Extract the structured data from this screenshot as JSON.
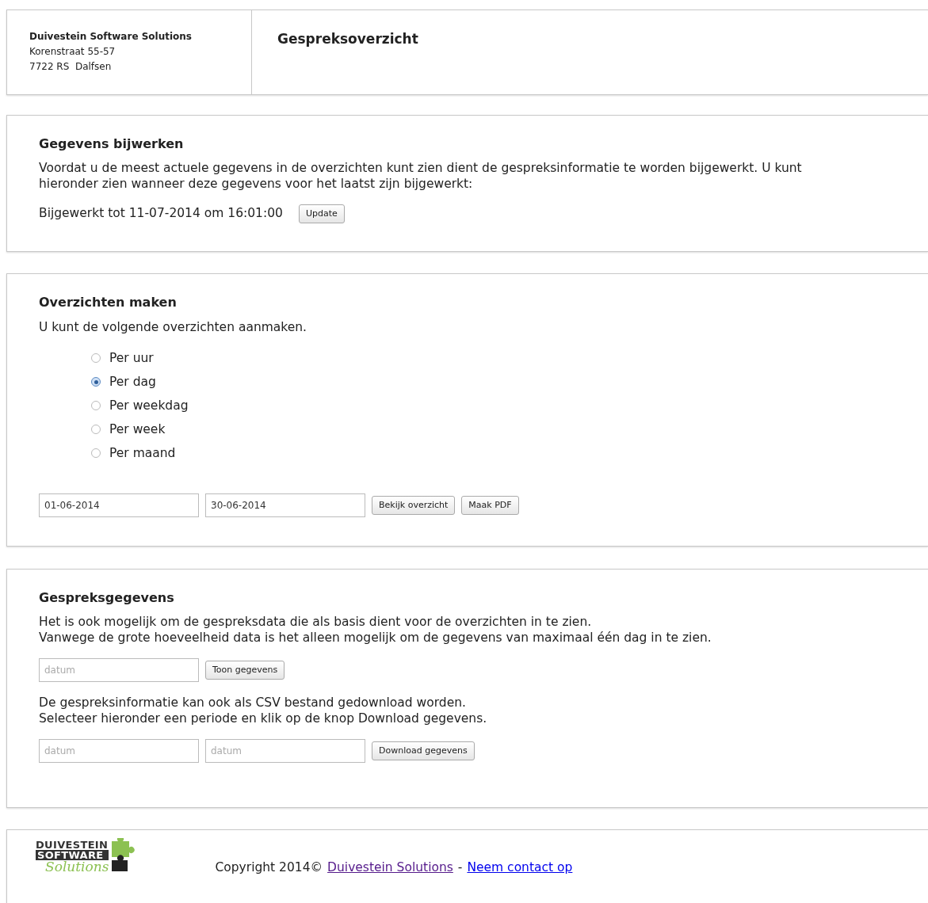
{
  "header": {
    "company": "Duivestein Software Solutions",
    "address_lines": [
      "Korenstraat 55-57",
      "7722 RS  Dalfsen"
    ],
    "title": "Gespreksoverzicht"
  },
  "update_panel": {
    "heading": "Gegevens bijwerken",
    "text": "Voordat u de meest actuele gegevens in de overzichten kunt zien dient de gespreksinformatie te worden bijgewerkt. U kunt hieronder zien wanneer deze gegevens voor het laatst zijn bijgewerkt:",
    "status": "Bijgewerkt tot 11-07-2014 om 16:01:00",
    "button": "Update"
  },
  "overview_panel": {
    "heading": "Overzichten maken",
    "text": "U kunt de volgende overzichten aanmaken.",
    "options": [
      {
        "label": "Per uur",
        "selected": false
      },
      {
        "label": "Per dag",
        "selected": true
      },
      {
        "label": "Per weekdag",
        "selected": false
      },
      {
        "label": "Per week",
        "selected": false
      },
      {
        "label": "Per maand",
        "selected": false
      }
    ],
    "from_date": "01-06-2014",
    "to_date": "30-06-2014",
    "buttons": [
      "Bekijk overzicht",
      "Maak PDF"
    ]
  },
  "data_panel": {
    "heading": "Gespreksgegevens",
    "text_lines": [
      "Het is ook mogelijk om de gespreksdata die als basis dient voor de overzichten in te zien.",
      "Vanwege de grote hoeveelheid data is het alleen mogelijk om de gegevens van maximaal één dag in te zien."
    ],
    "day_placeholder": "datum",
    "show_button": "Toon gegevens",
    "csv_lines": [
      "De gespreksinformatie kan ook als CSV bestand gedownload worden.",
      "Selecteer hieronder een periode en klik op de knop Download gegevens."
    ],
    "from_placeholder": "datum",
    "to_placeholder": "datum",
    "download_button": "Download gegevens"
  },
  "footer": {
    "logo": [
      "DUIVESTEIN",
      "SOFTWARE",
      "Solutions"
    ],
    "copyright": "Copyright 2014©",
    "links": [
      "Duivestein Solutions",
      "Neem contact op"
    ],
    "separator": "-"
  }
}
